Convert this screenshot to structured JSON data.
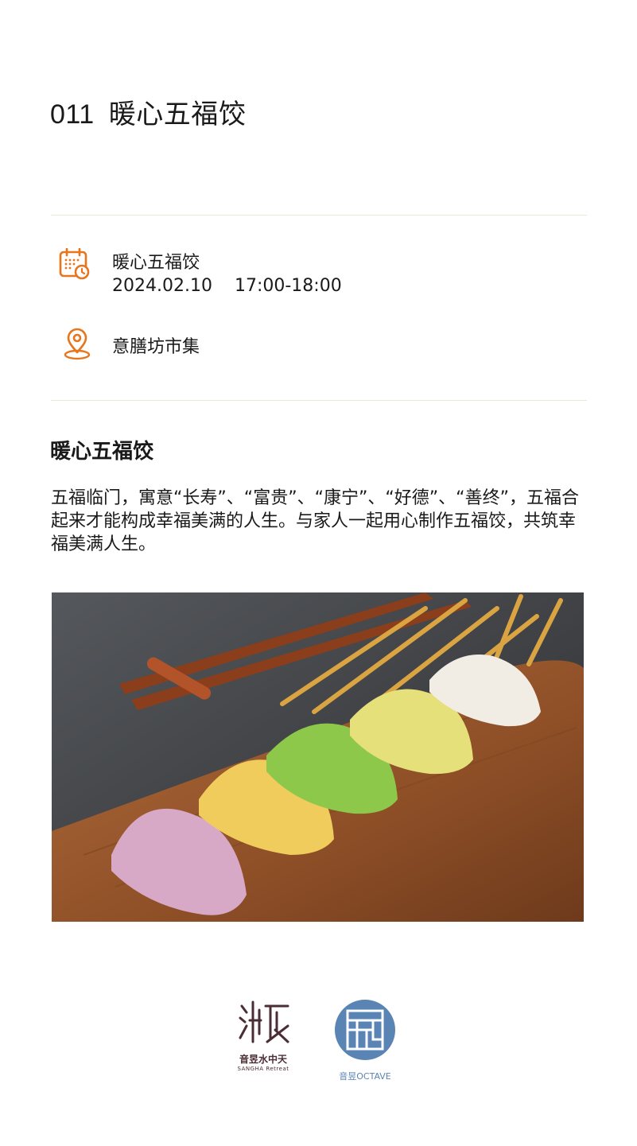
{
  "header": {
    "number": "011",
    "title": "暖心五福饺"
  },
  "event": {
    "name": "暖心五福饺",
    "date": "2024.02.10",
    "time": "17:00-18:00",
    "location": "意膳坊市集",
    "icon_calendar": "calendar-clock-icon",
    "icon_location": "location-pin-icon"
  },
  "section": {
    "title": "暖心五福饺",
    "description": "五福临门，寓意“长寿”、“富贵”、“康宁”、“好德”、“善终”，五福合起来才能构成幸福美满的人生。与家人一起用心制作五福饺，共筑幸福美满人生。"
  },
  "footer": {
    "logo1_caption": "音昱水中天",
    "logo1_sub": "SANGHA Retreat",
    "logo2_caption": "音昱OCTAVE"
  },
  "colors": {
    "accent": "#e8741c",
    "divider": "#ece6da",
    "logo1": "#4a2d35",
    "logo2": "#5a84b4"
  }
}
